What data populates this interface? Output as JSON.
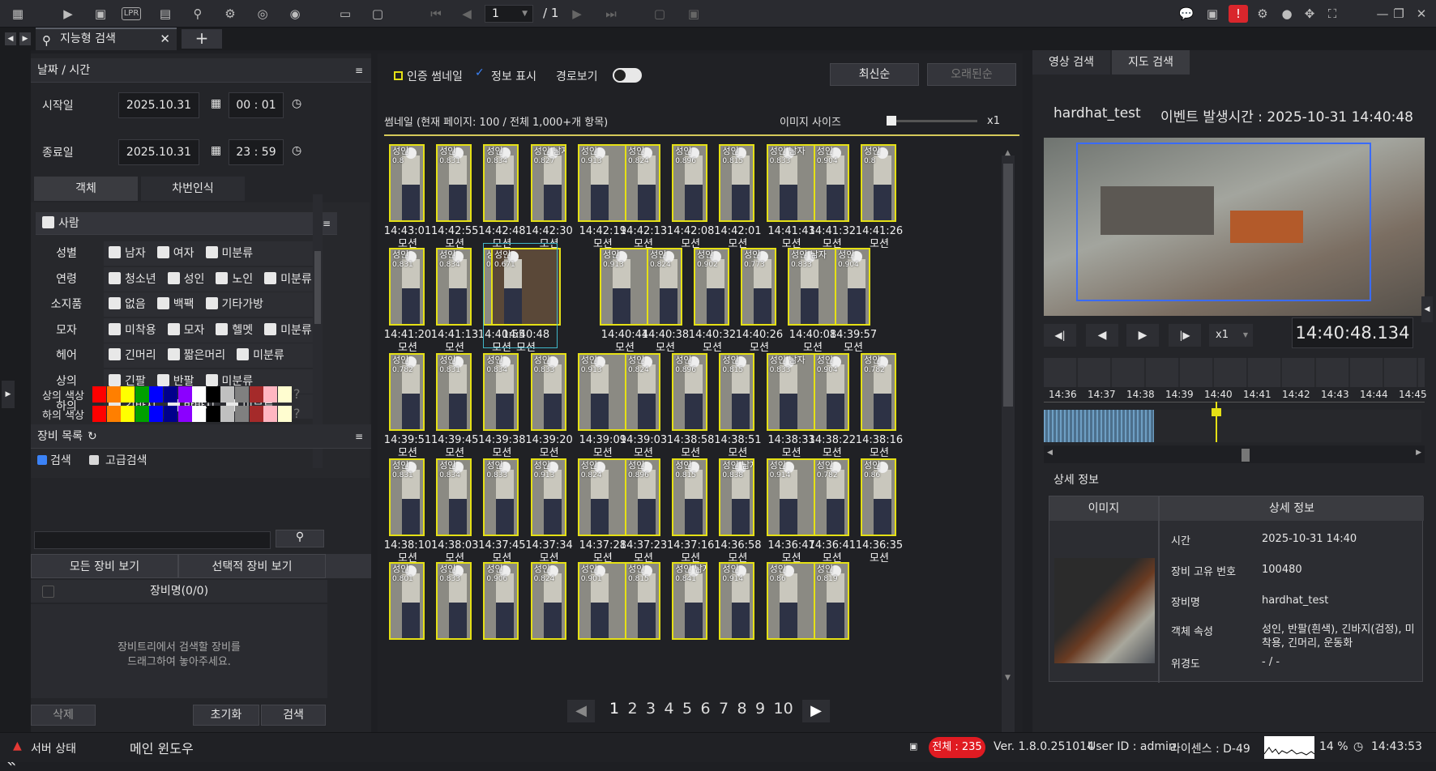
{
  "toolbar": {
    "page_current": "1",
    "page_total": "/ 1"
  },
  "tabs": {
    "main": "지능형 검색",
    "add": "+"
  },
  "date_time": {
    "title": "날짜 / 시간",
    "start_label": "시작일",
    "start_date": "2025.10.31",
    "start_time": "00 : 01",
    "end_label": "종료일",
    "end_date": "2025.10.31",
    "end_time": "23 : 59"
  },
  "search_tabs": [
    "객체",
    "차번인식"
  ],
  "person": {
    "title": "사람",
    "rows": [
      {
        "label": "성별",
        "options": [
          "남자",
          "여자",
          "미분류"
        ]
      },
      {
        "label": "연령",
        "options": [
          "청소년",
          "성인",
          "노인",
          "미분류"
        ]
      },
      {
        "label": "소지품",
        "options": [
          "없음",
          "백팩",
          "기타가방"
        ]
      },
      {
        "label": "모자",
        "options": [
          "미착용",
          "모자",
          "헬멧",
          "미분류"
        ]
      },
      {
        "label": "헤어",
        "options": [
          "긴머리",
          "짧은머리",
          "미분류"
        ]
      },
      {
        "label": "상의",
        "options": [
          "긴팔",
          "반팔",
          "미분류"
        ]
      },
      {
        "label": "하의",
        "options": [
          "긴바지",
          "반바지",
          "미분류"
        ]
      }
    ],
    "color_rows": [
      "상의 색상",
      "하의 색상"
    ],
    "palette": [
      "#ff0000",
      "#ff7f00",
      "#ffff00",
      "#00a000",
      "#0000ff",
      "#00008b",
      "#8b00ff",
      "#ffffff",
      "#000000",
      "#c0c0c0",
      "#808080",
      "#a52a2a",
      "#ffb6c1",
      "#fffdd0"
    ]
  },
  "device": {
    "title": "장비 목록",
    "search": "검색",
    "advanced": "고급검색",
    "all_view": "모든 장비 보기",
    "select_view": "선택적 장비 보기",
    "name_header": "장비명(0/0)",
    "hint1": "장비트리에서 검색할 장비를",
    "hint2": "드래그하여 놓아주세요.",
    "delete": "삭제",
    "reset": "초기화",
    "search_btn": "검색"
  },
  "center": {
    "auth_thumb": "인증 썸네일",
    "info_show": "정보 표시",
    "route": "경로보기",
    "newest": "최신순",
    "oldest": "오래된순",
    "summary": "썸네일 (현재 페이지: 100 / 전체 1,000+개 항목)",
    "image_size": "이미지 사이즈",
    "zoom": "x1"
  },
  "thumbs": [
    [
      [
        "성인",
        "0.8",
        "14:43:01",
        "모션"
      ],
      [
        "성인",
        "0.831",
        "14:42:55",
        "모션"
      ],
      [
        "성인",
        "0.834",
        "14:42:48",
        "모션"
      ],
      [
        "성인 남자",
        "0.827",
        "14:42:30",
        "모션"
      ],
      [
        "성인",
        "0.913",
        "14:42:19",
        "모션"
      ],
      [
        "성인",
        "0.824",
        "14:42:13",
        "모션"
      ],
      [
        "성인",
        "0.896",
        "14:42:08",
        "모션"
      ],
      [
        "성인",
        "0.815",
        "14:42:01",
        "모션"
      ],
      [
        "성인 남자",
        "0.833",
        "14:41:43",
        "모션"
      ],
      [
        "성인",
        "0.904",
        "14:41:32",
        "모션"
      ],
      [
        "성인",
        "0.8",
        "14:41:26",
        "모션"
      ]
    ],
    [
      [
        "성인",
        "0.831",
        "14:41:20",
        "모션"
      ],
      [
        "성인",
        "0.834",
        "14:41:13",
        "모션"
      ],
      [
        "성인 남자",
        "0.827",
        "14:40:55",
        "모션"
      ],
      [
        "성인",
        "0.671",
        "14:40:48",
        "모션"
      ],
      [
        "성인",
        "0.913",
        "14:40:44",
        "모션"
      ],
      [
        "성인",
        "0.824",
        "14:40:38",
        "모션"
      ],
      [
        "성인",
        "0.902",
        "14:40:32",
        "모션"
      ],
      [
        "성인",
        "0.773",
        "14:40:26",
        "모션"
      ],
      [
        "성인 남자",
        "0.833",
        "14:40:08",
        "모션"
      ],
      [
        "성인",
        "0.904",
        "14:39:57",
        "모션"
      ]
    ],
    [
      [
        "성인",
        "0.782",
        "14:39:51",
        "모션"
      ],
      [
        "성인",
        "0.831",
        "14:39:45",
        "모션"
      ],
      [
        "성인",
        "0.834",
        "14:39:38",
        "모션"
      ],
      [
        "성인",
        "0.833",
        "14:39:20",
        "모션"
      ],
      [
        "성인",
        "0.913",
        "14:39:09",
        "모션"
      ],
      [
        "성인",
        "0.824",
        "14:39:03",
        "모션"
      ],
      [
        "성인",
        "0.896",
        "14:38:58",
        "모션"
      ],
      [
        "성인",
        "0.815",
        "14:38:51",
        "모션"
      ],
      [
        "성인 남자",
        "0.833",
        "14:38:33",
        "모션"
      ],
      [
        "성인",
        "0.904",
        "14:38:22",
        "모션"
      ],
      [
        "성인",
        "0.782",
        "14:38:16",
        "모션"
      ]
    ],
    [
      [
        "성인",
        "0.831",
        "14:38:10",
        "모션"
      ],
      [
        "성인",
        "0.834",
        "14:38:03",
        "모션"
      ],
      [
        "성인",
        "0.833",
        "14:37:45",
        "모션"
      ],
      [
        "성인",
        "0.913",
        "14:37:34",
        "모션"
      ],
      [
        "성인",
        "0.824",
        "14:37:28",
        "모션"
      ],
      [
        "성인",
        "0.896",
        "14:37:23",
        "모션"
      ],
      [
        "성인",
        "0.815",
        "14:37:16",
        "모션"
      ],
      [
        "성인 남자",
        "0.838",
        "14:36:58",
        "모션"
      ],
      [
        "성인",
        "0.914",
        "14:36:47",
        "모션"
      ],
      [
        "성인",
        "0.782",
        "14:36:41",
        "모션"
      ],
      [
        "성인",
        "0.86",
        "14:36:35",
        "모션"
      ]
    ],
    [
      [
        "성인",
        "0.801",
        "",
        ""
      ],
      [
        "성인",
        "0.833",
        "",
        ""
      ],
      [
        "성인",
        "0.906",
        "",
        ""
      ],
      [
        "성인",
        "0.824",
        "",
        ""
      ],
      [
        "성인",
        "0.901",
        "",
        ""
      ],
      [
        "성인",
        "0.815",
        "",
        ""
      ],
      [
        "성인 남자",
        "0.841",
        "",
        ""
      ],
      [
        "성인",
        "0.914",
        "",
        ""
      ],
      [
        "성인",
        "0.86",
        "",
        ""
      ],
      [
        "성인",
        "0.819",
        "",
        ""
      ]
    ]
  ],
  "pages": [
    "1",
    "2",
    "3",
    "4",
    "5",
    "6",
    "7",
    "8",
    "9",
    "10"
  ],
  "right": {
    "tab_video": "영상 검색",
    "tab_map": "지도 검색",
    "device_name": "hardhat_test",
    "event_time": "이벤트 발생시간 : 2025-10-31 14:40:48",
    "speed": "x1",
    "timecode": "14:40:48.134",
    "timeline": [
      "14:36",
      "14:37",
      "14:38",
      "14:39",
      "14:40",
      "14:41",
      "14:42",
      "14:43",
      "14:44",
      "14:45"
    ],
    "detail_title": "상세 정보",
    "col_image": "이미지",
    "col_detail": "상세 정보",
    "details": [
      {
        "k": "시간",
        "v": "2025-10-31 14:40"
      },
      {
        "k": "장비 고유 번호",
        "v": "100480"
      },
      {
        "k": "장비명",
        "v": "hardhat_test"
      },
      {
        "k": "객체 속성",
        "v": "성인, 반팔(흰색), 긴바지(검정), 미착용, 긴머리, 운동화"
      },
      {
        "k": "위경도",
        "v": "- / -"
      }
    ]
  },
  "status": {
    "server": "서버 상태",
    "window": "메인 윈도우",
    "total": "전체 : 235",
    "version": "Ver. 1.8.0.251014",
    "user": "User ID : admin",
    "license": "라이센스 : D-49",
    "cpu": "14 %",
    "clock": "14:43:53"
  }
}
